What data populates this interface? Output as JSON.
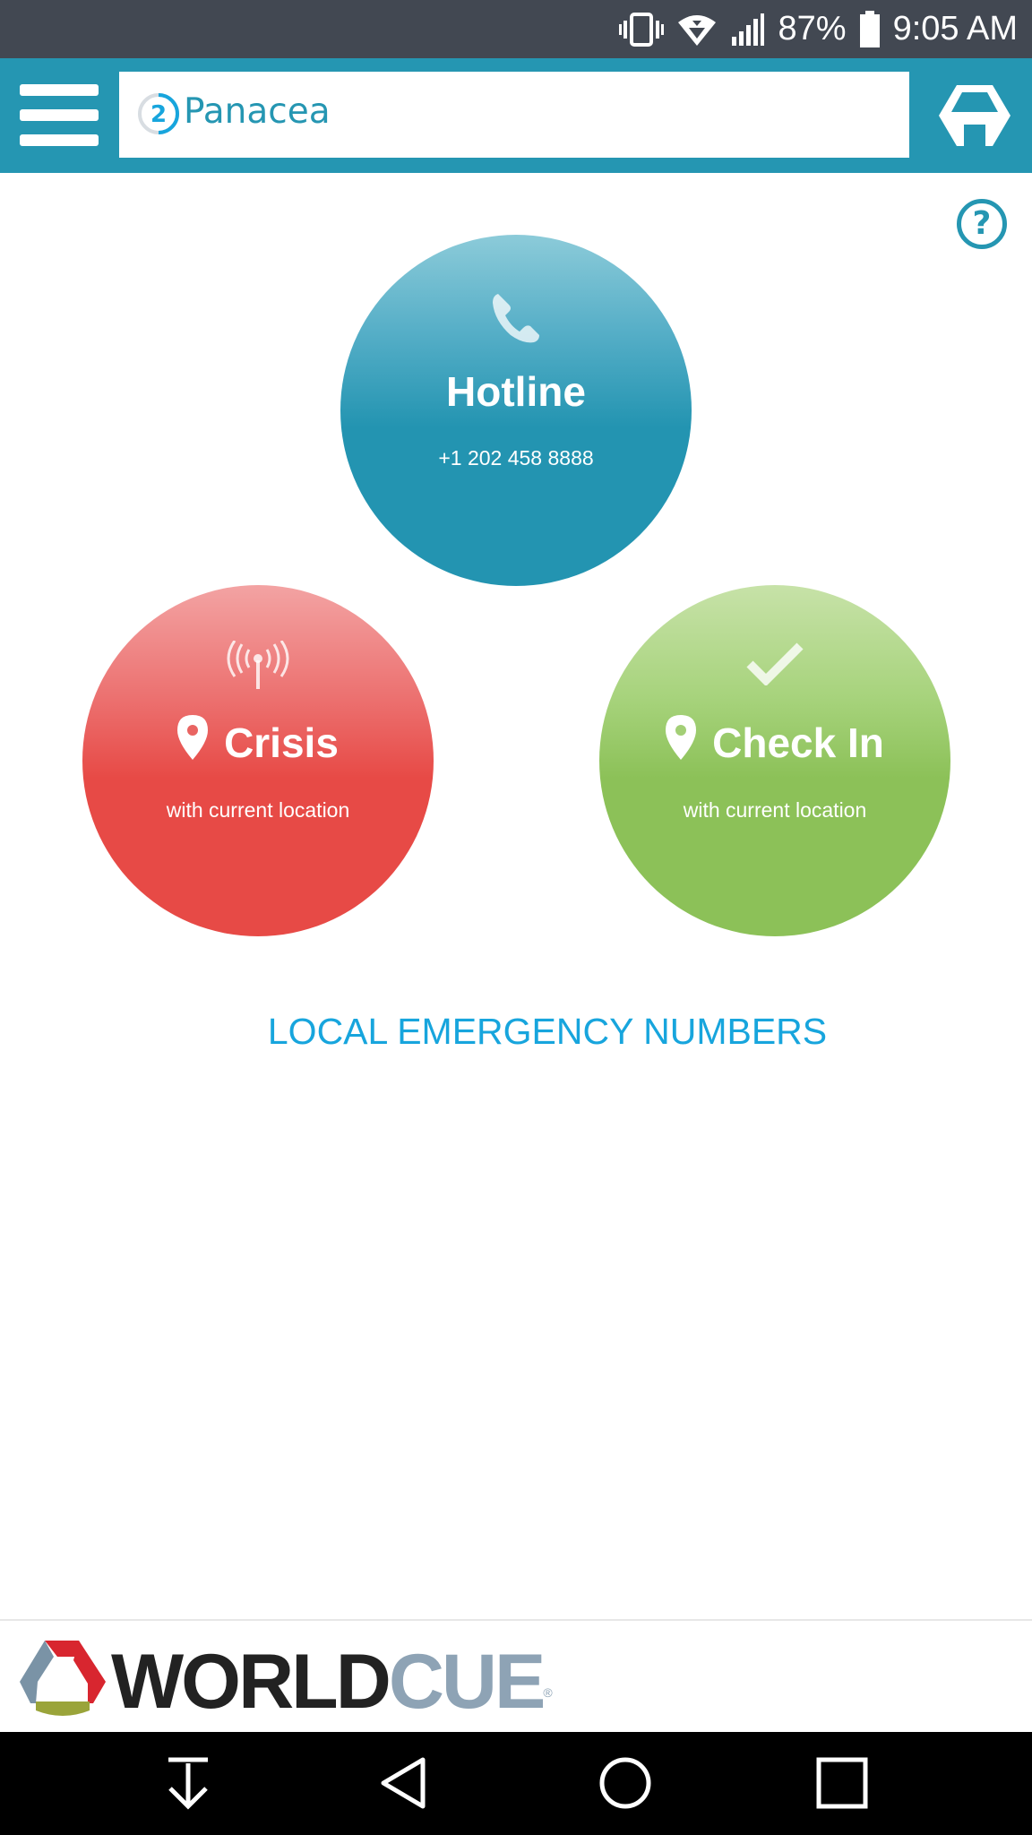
{
  "status_bar": {
    "battery_percent": "87%",
    "time": "9:05 AM",
    "icons": [
      "vibrate-icon",
      "wifi-icon",
      "signal-icon",
      "battery-icon"
    ]
  },
  "header": {
    "app_name": "Panacea",
    "badge_number": "2",
    "menu_icon": "hamburger-menu-icon",
    "brand_icon": "worldcue-mark-icon"
  },
  "help": {
    "label": "?"
  },
  "actions": {
    "hotline": {
      "title": "Hotline",
      "subtitle": "+1 202 458 8888",
      "icon": "phone-icon"
    },
    "crisis": {
      "title": "Crisis",
      "subtitle": "with current location",
      "icon": "broadcast-icon",
      "title_icon": "location-pin-icon"
    },
    "checkin": {
      "title": "Check In",
      "subtitle": "with current location",
      "icon": "checkmark-icon",
      "title_icon": "location-pin-icon"
    }
  },
  "emergency_link": {
    "label": "LOCAL EMERGENCY NUMBERS"
  },
  "footer": {
    "logo_word_dark": "WORLD",
    "logo_word_light": "CUE",
    "registered": "®"
  },
  "navbar": {
    "buttons": [
      "download-icon",
      "back-icon",
      "home-icon",
      "recents-icon"
    ]
  },
  "colors": {
    "primary": "#2596b2",
    "crisis": "#e74a46",
    "checkin": "#8cc158",
    "link": "#17a5dd",
    "status_bar": "#424852"
  }
}
